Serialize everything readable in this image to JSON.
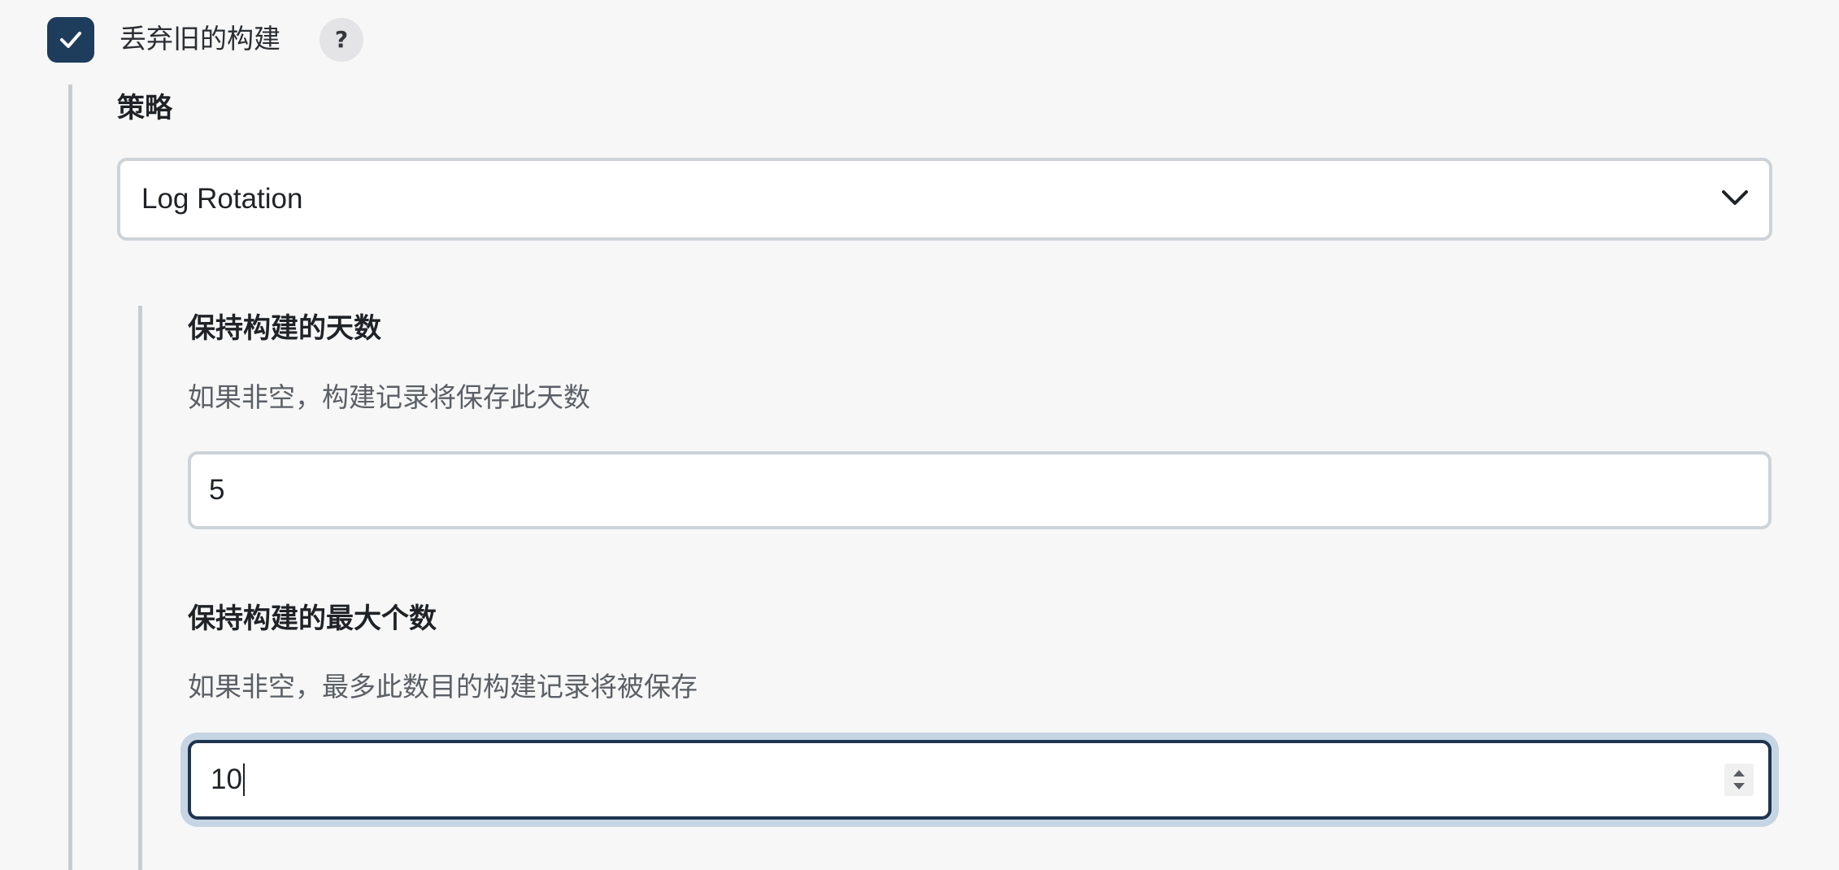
{
  "discard_builds": {
    "label": "丢弃旧的构建",
    "checked": true,
    "help_icon": "question-mark-icon",
    "help_glyph": "?"
  },
  "strategy": {
    "label": "策略",
    "selected": "Log Rotation",
    "dropdown_icon": "chevron-down-icon"
  },
  "days_to_keep": {
    "title": "保持构建的天数",
    "description": "如果非空，构建记录将保存此天数",
    "value": "5"
  },
  "max_builds": {
    "title": "保持构建的最大个数",
    "description": "如果非空，最多此数目的构建记录将被保存",
    "value": "10",
    "focused": true,
    "spinner_icon": "number-spinner-icon"
  },
  "colors": {
    "accent": "#1e3c5b",
    "focus_ring": "#c6d5e3",
    "border": "#ced3d8",
    "background": "#f7f7f7"
  }
}
